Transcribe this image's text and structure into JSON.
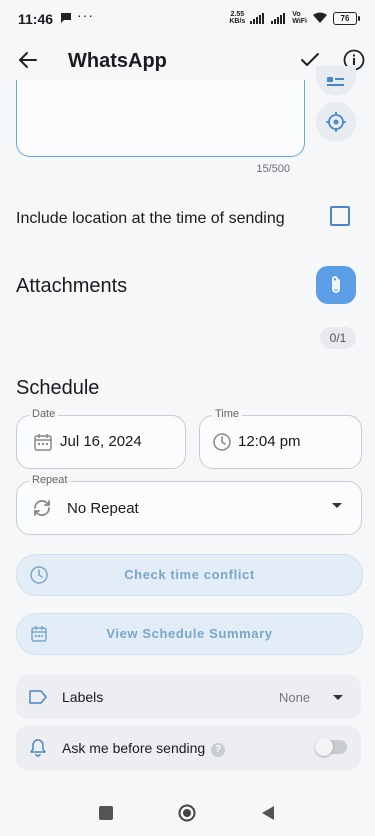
{
  "status_bar": {
    "time": "11:46",
    "dots": "···",
    "net_speed_value": "2.55",
    "net_speed_unit": "KB/s",
    "volte_top": "Vo",
    "volte_bottom": "WiFi",
    "battery": "76"
  },
  "app_bar": {
    "title": "WhatsApp"
  },
  "message": {
    "counter": "15/500"
  },
  "location": {
    "label": "Include location at the time of sending",
    "checked": false
  },
  "attachments": {
    "title": "Attachments",
    "count": "0/1"
  },
  "schedule": {
    "title": "Schedule",
    "date_label": "Date",
    "date_value": "Jul 16, 2024",
    "time_label": "Time",
    "time_value": "12:04 pm",
    "repeat_label": "Repeat",
    "repeat_value": "No Repeat"
  },
  "buttons": {
    "check_conflict": "Check time conflict",
    "view_summary": "View Schedule Summary"
  },
  "labels_row": {
    "label": "Labels",
    "value": "None"
  },
  "ask_row": {
    "label": "Ask me before sending",
    "help": "?",
    "enabled": false
  },
  "colors": {
    "accent": "#5b9ee6",
    "pill_bg": "#e3edf7",
    "pill_text": "#7aa6c8"
  },
  "icons": [
    "back-arrow-icon",
    "check-icon",
    "info-icon",
    "contact-card-icon",
    "location-pin-icon",
    "paperclip-icon",
    "calendar-icon",
    "clock-icon",
    "repeat-icon",
    "dropdown-arrow-icon",
    "label-tag-icon",
    "bell-icon",
    "nav-square-icon",
    "nav-circle-icon",
    "nav-back-triangle-icon"
  ]
}
